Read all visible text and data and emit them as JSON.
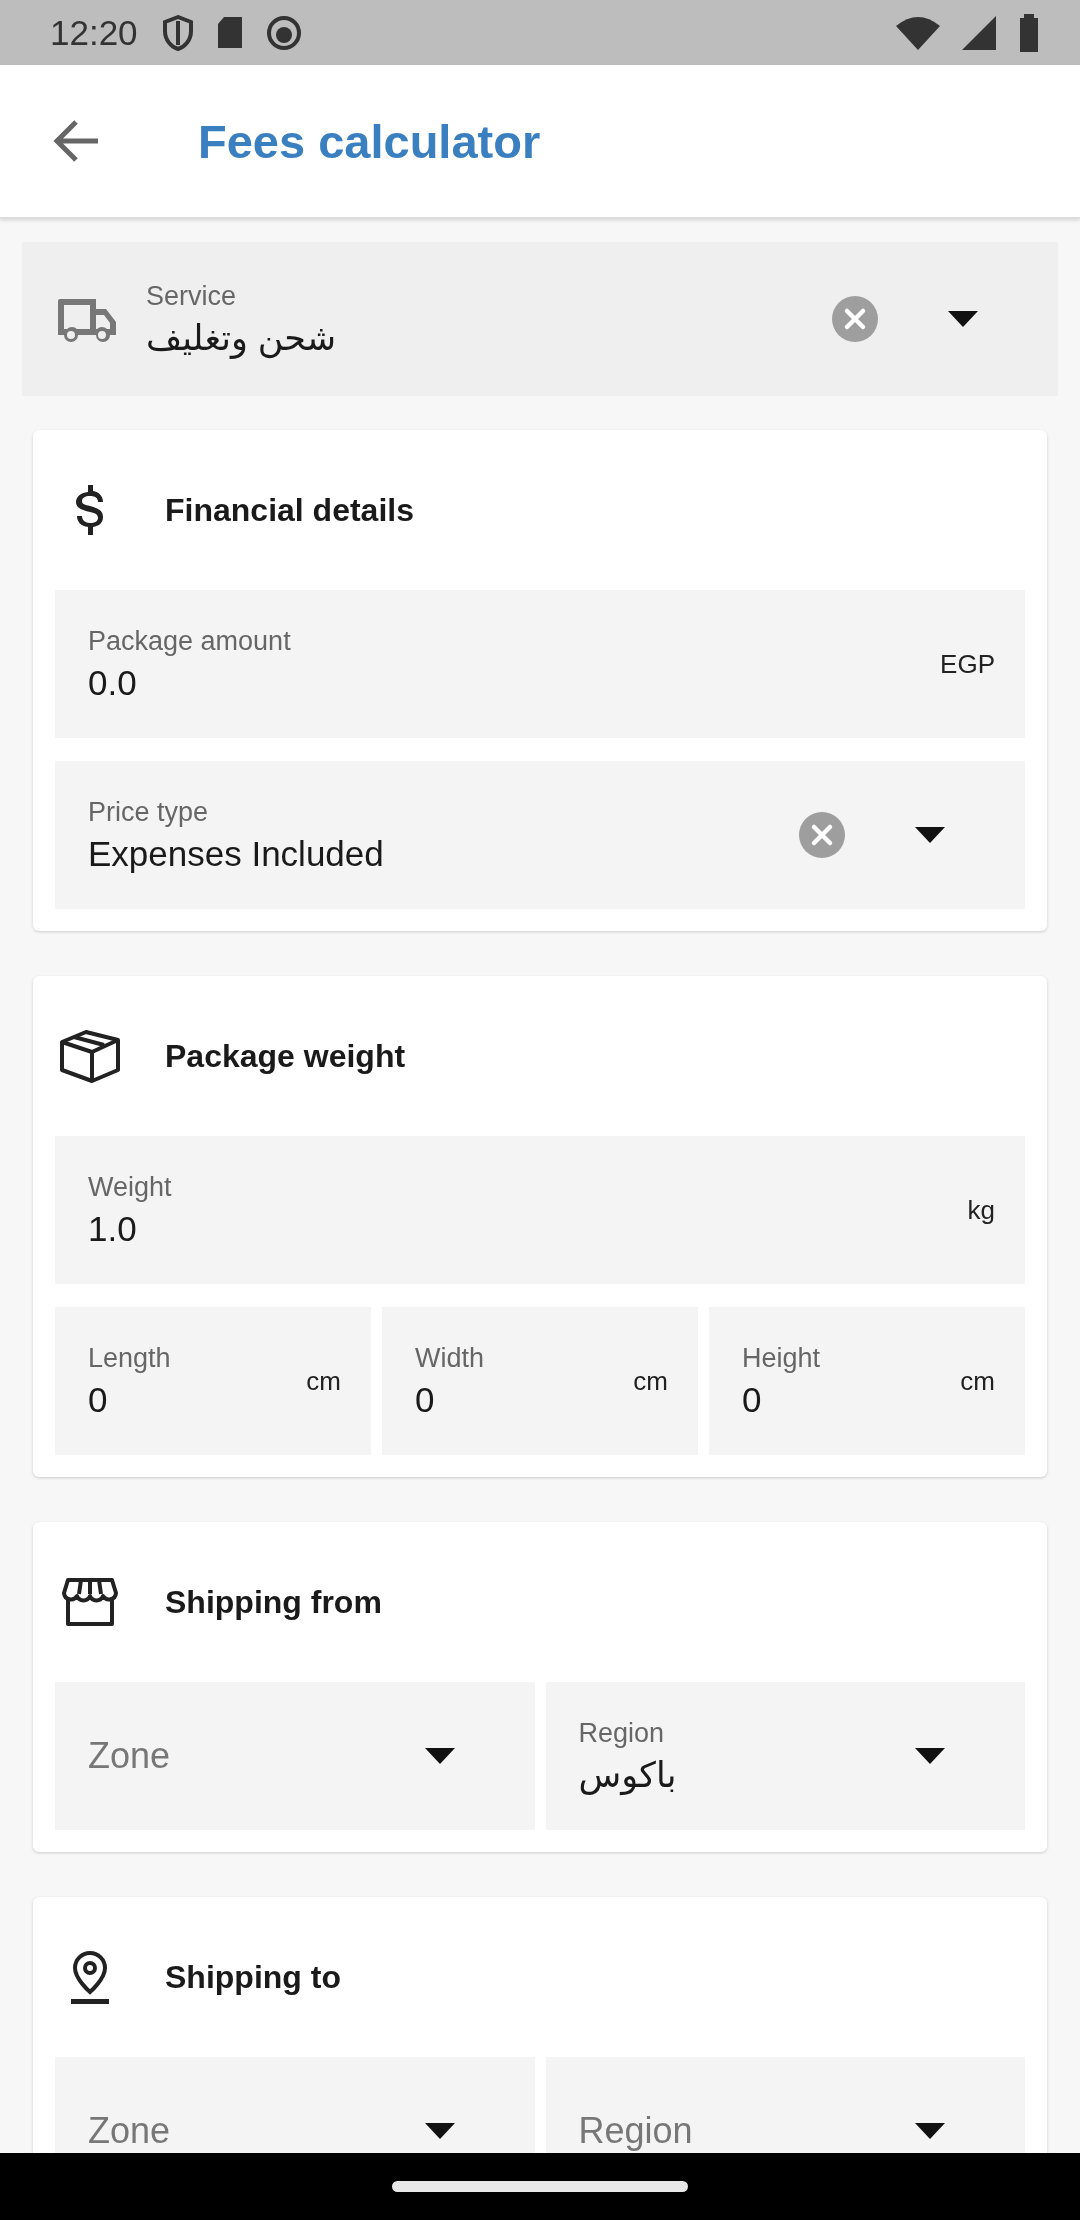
{
  "status_bar": {
    "time": "12:20"
  },
  "app_bar": {
    "title": "Fees calculator"
  },
  "service": {
    "kind": "dropdown",
    "label": "Service",
    "value": "شحن وتغليف",
    "clearable": true
  },
  "sections": [
    {
      "title": "Financial details",
      "rows": [
        [
          {
            "kind": "text",
            "label": "Package amount",
            "value": "0.0",
            "suffix": "EGP"
          }
        ],
        [
          {
            "kind": "dropdown",
            "label": "Price type",
            "value": "Expenses Included",
            "clearable": true
          }
        ]
      ]
    },
    {
      "title": "Package weight",
      "rows": [
        [
          {
            "kind": "text",
            "label": "Weight",
            "value": "1.0",
            "suffix": "kg"
          }
        ],
        [
          {
            "kind": "text",
            "label": "Length",
            "value": "0",
            "suffix": "cm"
          },
          {
            "kind": "text",
            "label": "Width",
            "value": "0",
            "suffix": "cm"
          },
          {
            "kind": "text",
            "label": "Height",
            "value": "0",
            "suffix": "cm"
          }
        ]
      ]
    },
    {
      "title": "Shipping from",
      "rows": [
        [
          {
            "kind": "dropdown",
            "placeholder": "Zone",
            "clearable": false
          },
          {
            "kind": "dropdown",
            "label": "Region",
            "value": "باكوس",
            "clearable": false
          }
        ]
      ]
    },
    {
      "title": "Shipping to",
      "rows": [
        [
          {
            "kind": "dropdown",
            "placeholder": "Zone",
            "clearable": false
          },
          {
            "kind": "dropdown",
            "placeholder": "Region",
            "clearable": false
          }
        ]
      ]
    }
  ]
}
